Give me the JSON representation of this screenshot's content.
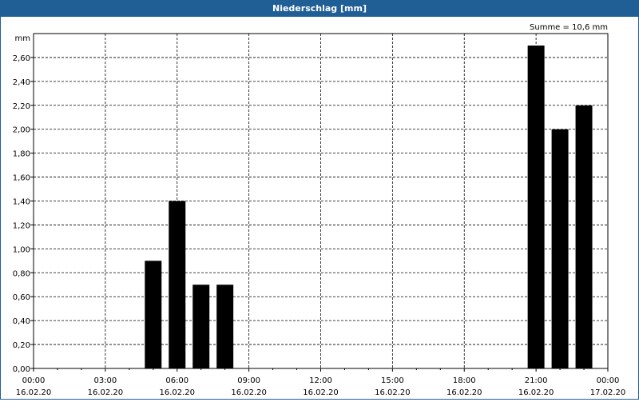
{
  "window": {
    "title": "Niederschlag [mm]"
  },
  "chart_data": {
    "type": "bar",
    "title": "Niederschlag [mm]",
    "ylabel": "mm",
    "annotation": "Summe = 10,6 mm",
    "ylim": [
      0,
      2.8
    ],
    "y_ticks": [
      "0,00",
      "0,20",
      "0,40",
      "0,60",
      "0,80",
      "1,00",
      "1,20",
      "1,40",
      "1,60",
      "1,80",
      "2,00",
      "2,20",
      "2,40",
      "2,60"
    ],
    "x_ticks": [
      {
        "time": "00:00",
        "date": "16.02.20"
      },
      {
        "time": "03:00",
        "date": "16.02.20"
      },
      {
        "time": "06:00",
        "date": "16.02.20"
      },
      {
        "time": "09:00",
        "date": "16.02.20"
      },
      {
        "time": "12:00",
        "date": "16.02.20"
      },
      {
        "time": "15:00",
        "date": "16.02.20"
      },
      {
        "time": "18:00",
        "date": "16.02.20"
      },
      {
        "time": "21:00",
        "date": "16.02.20"
      },
      {
        "time": "00:00",
        "date": "17.02.20"
      }
    ],
    "bars": [
      {
        "time": "05:00",
        "value": 0.9
      },
      {
        "time": "06:00",
        "value": 1.4
      },
      {
        "time": "07:00",
        "value": 0.7
      },
      {
        "time": "08:00",
        "value": 0.7
      },
      {
        "time": "21:00",
        "value": 2.7
      },
      {
        "time": "22:00",
        "value": 2.0
      },
      {
        "time": "23:00",
        "value": 2.2
      }
    ],
    "grid": true,
    "bar_color": "#000000"
  }
}
